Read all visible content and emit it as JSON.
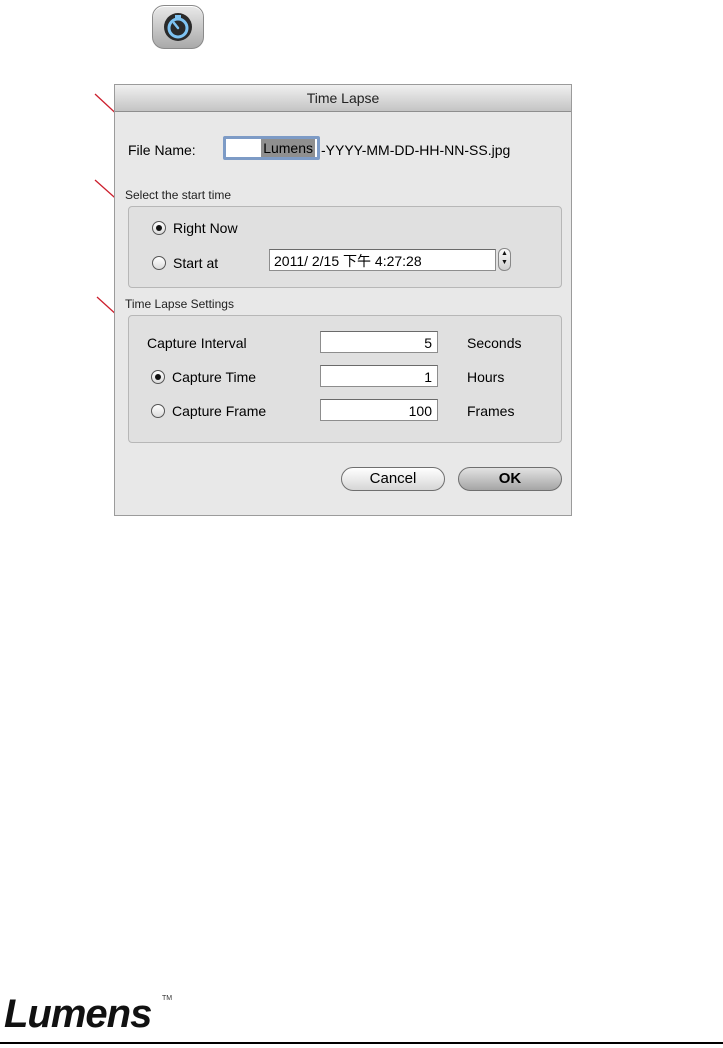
{
  "dialog": {
    "title": "Time Lapse",
    "file_name_label": "File Name:",
    "file_name_value": "Lumens",
    "file_name_suffix": "-YYYY-MM-DD-HH-NN-SS.jpg",
    "start_group": {
      "title": "Select the start time",
      "right_now_label": "Right Now",
      "start_at_label": "Start at",
      "start_at_value": "2011/  2/15 下午   4:27:28",
      "selected": "Right Now"
    },
    "settings_group": {
      "title": "Time Lapse Settings",
      "capture_interval_label": "Capture Interval",
      "capture_interval_value": "5",
      "capture_interval_unit": "Seconds",
      "capture_time_label": "Capture Time",
      "capture_time_value": "1",
      "capture_time_unit": "Hours",
      "capture_frame_label": "Capture Frame",
      "capture_frame_value": "100",
      "capture_frame_unit": "Frames",
      "selected": "Capture Time"
    },
    "cancel_label": "Cancel",
    "ok_label": "OK"
  },
  "icons": {
    "timer": "timer-icon",
    "stepper_up": "▲",
    "stepper_down": "▼"
  },
  "footer": {
    "logo": "Lumens",
    "trademark": "TM"
  },
  "colors": {
    "annotation": "#cc1f2d",
    "dialog_bg": "#e8e8e8",
    "focus_ring": "#7d9bc6"
  }
}
